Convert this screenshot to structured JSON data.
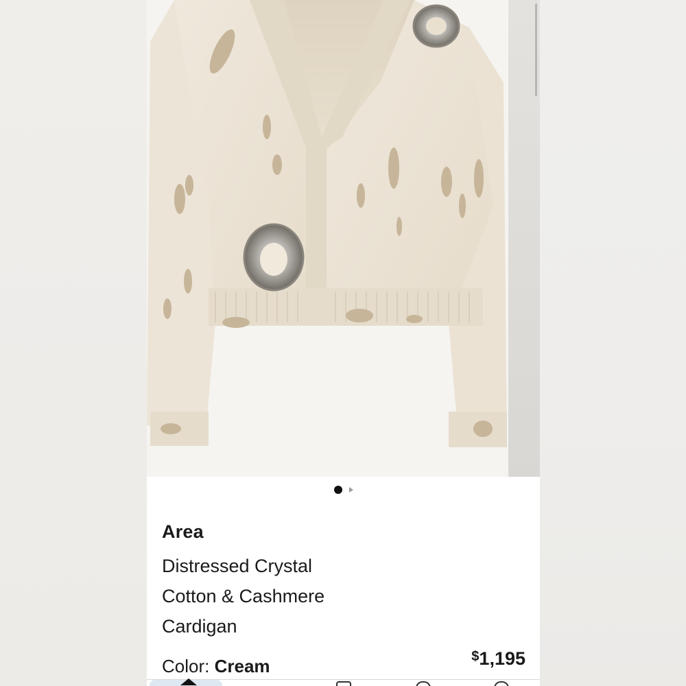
{
  "product": {
    "brand": "Area",
    "title_lines": [
      "Distressed Crystal",
      "Cotton & Cashmere",
      "Cardigan"
    ],
    "price": "$1,195",
    "price_symbol": "$",
    "price_amount": "1,195",
    "color_label": "Color:",
    "color_value": "Cream"
  },
  "carousel": {
    "image_count": 2,
    "active_index": 1,
    "image_description": "cream distressed cardigan with crystal brooches"
  },
  "tabbar": {
    "tabs": [
      "home-icon",
      "shop-icon",
      "wishlist-icon",
      "account-icon"
    ],
    "active": "home-icon"
  },
  "colors": {
    "cardigan": "#ece4d6",
    "accent_tab": "#dde8f2",
    "text": "#1a1a1a"
  }
}
